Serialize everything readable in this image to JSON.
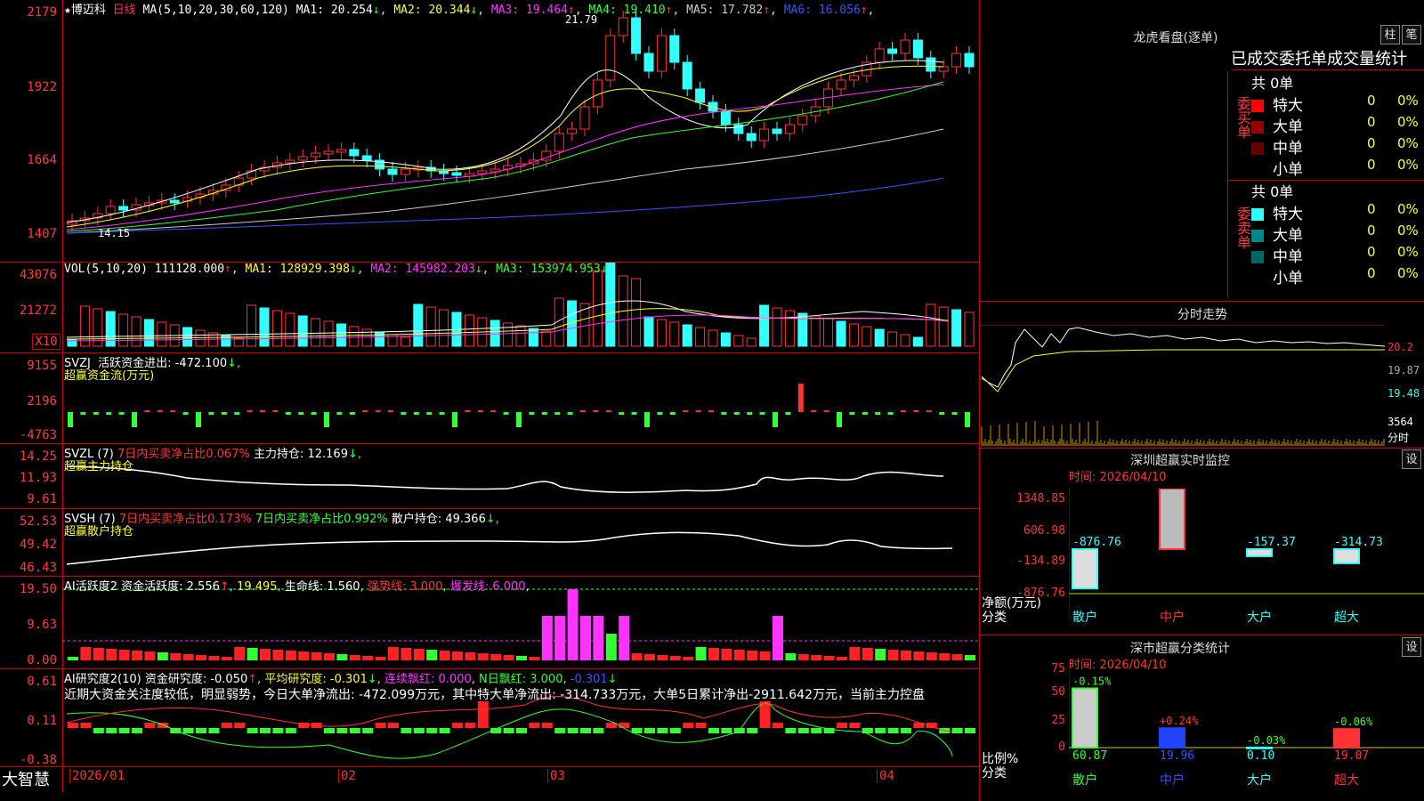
{
  "stock": {
    "name": "博迈科",
    "period": "日线",
    "star": "★"
  },
  "main": {
    "ma_header": "MA(5,10,20,30,60,120)",
    "ma": [
      {
        "label": "MA1:",
        "value": "20.254",
        "arrow": "↓",
        "color": "#ffffff"
      },
      {
        "label": "MA2:",
        "value": "20.344",
        "arrow": "↓",
        "color": "#ffff33"
      },
      {
        "label": "MA3:",
        "value": "19.464",
        "arrow": "↑",
        "color": "#ff33ff"
      },
      {
        "label": "MA4:",
        "value": "19.410",
        "arrow": "↑",
        "color": "#33ff33"
      },
      {
        "label": "MA5:",
        "value": "17.782",
        "arrow": "↑",
        "color": "#cccccc"
      },
      {
        "label": "MA6:",
        "value": "16.056",
        "arrow": "↑",
        "color": "#3355ff"
      }
    ],
    "yticks": [
      "2179",
      "1922",
      "1664",
      "1407"
    ],
    "high_label": "21.79",
    "low_label": "14.15"
  },
  "vol": {
    "header": "VOL(5,10,20)",
    "value": "111128.000",
    "arrow": "↑",
    "ma1": "MA1: 128929.398",
    "ma1a": "↓",
    "ma2": "MA2: 145982.203",
    "ma2a": "↓",
    "ma3": "MA3: 153974.953",
    "ma3a": "↓",
    "yticks": [
      "43076",
      "21272"
    ],
    "unit": "X10"
  },
  "svzj": {
    "header": "SVZJ",
    "label": "活跃资金进出: -472.100",
    "arrow": "↓,",
    "sub": "超赢资金流(万元)",
    "yticks": [
      "9155",
      "2196",
      "-4763"
    ]
  },
  "svzl": {
    "header": "SVZL (7)",
    "t1": "7日内买卖净占比0.067%",
    "t2": "主力持仓: 12.169",
    "arrow": "↓,",
    "sub": "超赢主力持仓",
    "yticks": [
      "14.25",
      "11.93",
      "9.61"
    ]
  },
  "svsh": {
    "header": "SVSH (7)",
    "t1": "7日内买卖净占比0.173%",
    "t2": "7日内买卖净占比0.992%",
    "t3": "散户持仓: 49.366",
    "arrow": "↓,",
    "sub": "超赢散户持仓",
    "yticks": [
      "52.53",
      "49.42",
      "46.43"
    ]
  },
  "ai1": {
    "header": "AI活跃度2",
    "t1": "资金活跃度: 2.556",
    "t1a": "↑",
    "t2": "19.495",
    "t3": "生命线: 1.560",
    "t4": "强势线: 3.000",
    "t5": "爆发线: 6.000",
    "yticks": [
      "19.50",
      "9.63",
      "0.00"
    ]
  },
  "ai2": {
    "header": "AI研究度2(10)",
    "t1": "资金研究度: -0.050",
    "t1a": "↑",
    "t2": "平均研究度: -0.301",
    "t2a": "↓",
    "t3": "连续飘红: 0.000",
    "t4": "N日飘红: 3.000",
    "t5": "-0.301",
    "t5a": "↓",
    "comment": "近期大资金关注度较低，明显弱势，今日大单净流出: -472.099万元，其中特大单净流出: -314.733万元，大单5日累计净出-2911.642万元，当前主力控盘",
    "yticks": [
      "0.61",
      "0.11",
      "-0.38"
    ]
  },
  "xaxis": {
    "brand": "大智慧",
    "labels": [
      "2026/01",
      "02",
      "03",
      "04"
    ]
  },
  "longhu": {
    "title": "龙虎看盘(逐单)",
    "btn1": "柱",
    "btn2": "笔",
    "header": "已成交委托单成交量统计",
    "buy": {
      "side": "委买单",
      "total": "共 0单",
      "rows": [
        {
          "label": "特大",
          "color": "#ff0000",
          "v": "0",
          "p": "0%"
        },
        {
          "label": "大单",
          "color": "#990000",
          "v": "0",
          "p": "0%"
        },
        {
          "label": "中单",
          "color": "#660000",
          "v": "0",
          "p": "0%"
        },
        {
          "label": "小单",
          "color": "#000000",
          "v": "0",
          "p": "0%"
        }
      ]
    },
    "sell": {
      "side": "委卖单",
      "total": "共 0单",
      "rows": [
        {
          "label": "特大",
          "color": "#33ffff",
          "v": "0",
          "p": "0%"
        },
        {
          "label": "大单",
          "color": "#008888",
          "v": "0",
          "p": "0%"
        },
        {
          "label": "中单",
          "color": "#006666",
          "v": "0",
          "p": "0%"
        },
        {
          "label": "小单",
          "color": "#000000",
          "v": "0",
          "p": "0%"
        }
      ]
    }
  },
  "fenshi": {
    "title": "分时走势",
    "yticks": [
      "20.2",
      "19.87",
      "19.48",
      "3564"
    ],
    "unit": "分时"
  },
  "monitor": {
    "title": "深圳超赢实时监控",
    "btn": "设",
    "time": "时间: 2026/04/10",
    "yticks": [
      "1348.85",
      "606.98",
      "-134.89",
      "-876.76"
    ],
    "ylabel1": "净额(万元)",
    "ylabel2": "分类",
    "bars": [
      {
        "cat": "散户",
        "value": "-876.76"
      },
      {
        "cat": "中户",
        "value": "1348.85"
      },
      {
        "cat": "大户",
        "value": "-157.37"
      },
      {
        "cat": "超大",
        "value": "-314.73"
      }
    ]
  },
  "classify": {
    "title": "深市超赢分类统计",
    "btn": "设",
    "time": "时间: 2026/04/10",
    "yticks": [
      "75",
      "50",
      "25",
      "0"
    ],
    "ylabel1": "比例%",
    "ylabel2": "分类",
    "bars": [
      {
        "cat": "散户",
        "value": 60.87,
        "label": "60.87",
        "pct": "-0.15%"
      },
      {
        "cat": "中户",
        "value": 19.96,
        "label": "19.96",
        "pct": "+0.24%"
      },
      {
        "cat": "大户",
        "value": 0.1,
        "label": "0.10",
        "pct": "-0.03%"
      },
      {
        "cat": "超大",
        "value": 19.07,
        "label": "19.07",
        "pct": "-0.06%"
      }
    ]
  }
}
